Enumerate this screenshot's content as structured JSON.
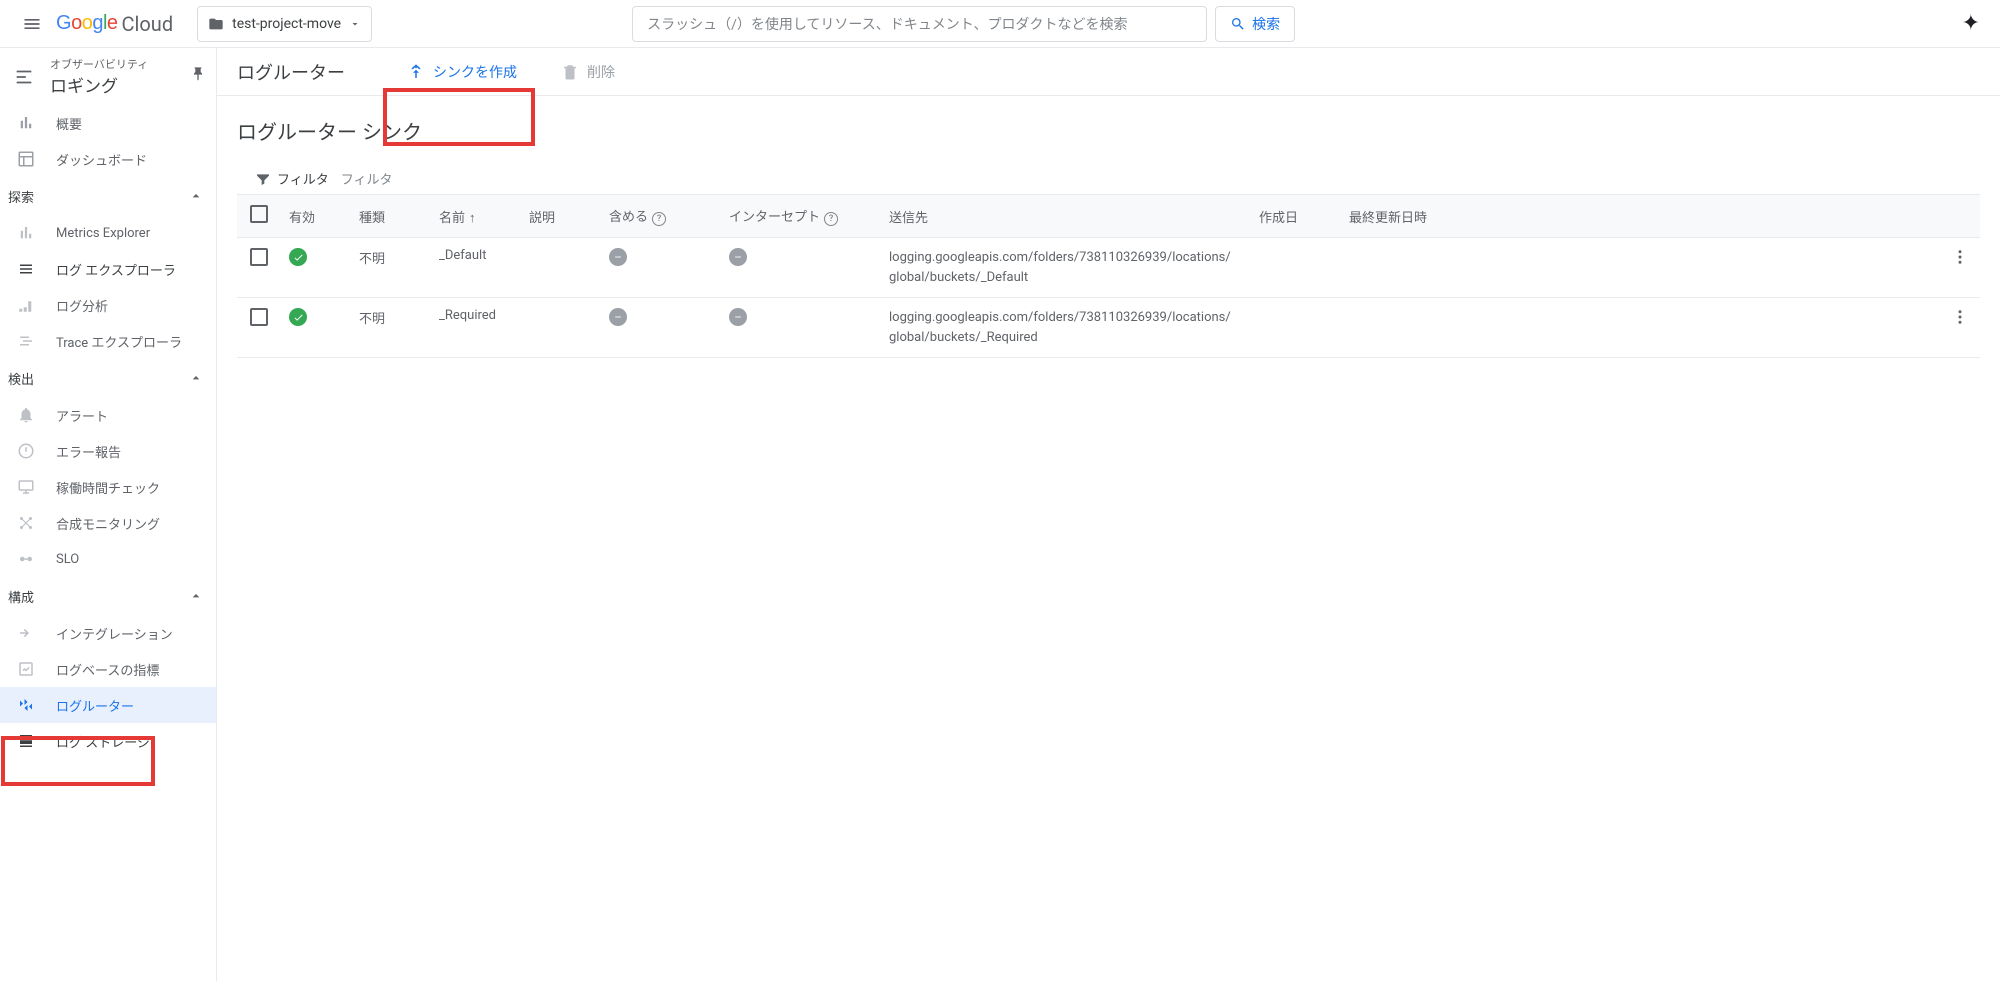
{
  "header": {
    "logo_cloud": "Cloud",
    "project_name": "test-project-move",
    "search_placeholder": "スラッシュ（/）を使用してリソース、ドキュメント、プロダクトなどを検索",
    "search_button": "検索"
  },
  "sidebar": {
    "subtitle": "オブザーバビリティ",
    "title": "ロギング",
    "items_top": [
      {
        "label": "概要"
      },
      {
        "label": "ダッシュボード"
      }
    ],
    "group_explore": "探索",
    "items_explore": [
      {
        "label": "Metrics Explorer"
      },
      {
        "label": "ログ エクスプローラ",
        "dark": true
      },
      {
        "label": "ログ分析"
      },
      {
        "label": "Trace エクスプローラ"
      }
    ],
    "group_detect": "検出",
    "items_detect": [
      {
        "label": "アラート"
      },
      {
        "label": "エラー報告"
      },
      {
        "label": "稼働時間チェック"
      },
      {
        "label": "合成モニタリング"
      },
      {
        "label": "SLO"
      }
    ],
    "group_configure": "構成",
    "items_configure": [
      {
        "label": "インテグレーション"
      },
      {
        "label": "ログベースの指標"
      },
      {
        "label": "ログルーター",
        "active": true
      },
      {
        "label": "ログ ストレージ",
        "dark": true
      }
    ]
  },
  "toolbar": {
    "page_title": "ログルーター",
    "create_sink": "シンクを作成",
    "delete": "削除"
  },
  "content": {
    "section_title": "ログルーター シンク",
    "filter_label": "フィルタ",
    "filter_placeholder": "フィルタ",
    "columns": {
      "enabled": "有効",
      "type": "種類",
      "name": "名前",
      "description": "説明",
      "include": "含める",
      "intercept": "インターセプト",
      "destination": "送信先",
      "created": "作成日",
      "updated": "最終更新日時"
    },
    "rows": [
      {
        "type": "不明",
        "name": "_Default",
        "destination_l1": "logging.googleapis.com/folders/738110326939/locations/",
        "destination_l2": "global/buckets/_Default"
      },
      {
        "type": "不明",
        "name": "_Required",
        "destination_l1": "logging.googleapis.com/folders/738110326939/locations/",
        "destination_l2": "global/buckets/_Required"
      }
    ]
  }
}
